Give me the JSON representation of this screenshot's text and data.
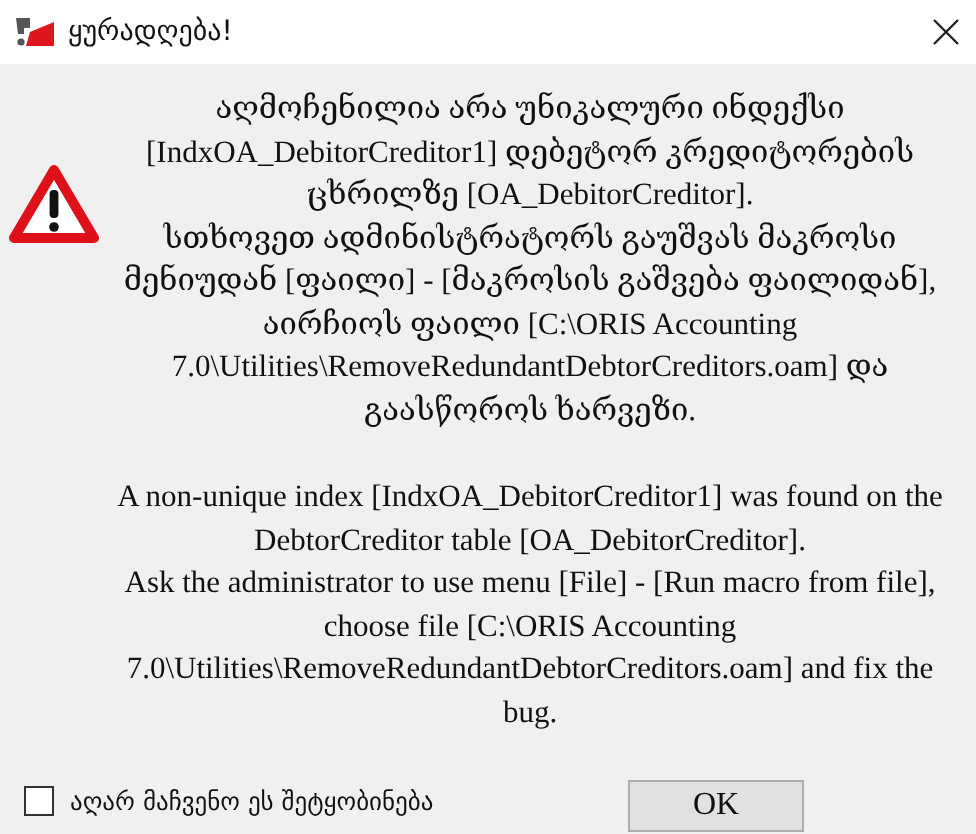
{
  "window": {
    "title": "ყურადღება!"
  },
  "message": {
    "georgian": [
      "აღმოჩენილია არა უნიკალური ინდექსი [IndxOA_DebitorCreditor1] დებეტორ კრედიტორების ცხრილზე [OA_DebitorCreditor].",
      "სთხოვეთ ადმინისტრატორს გაუშვას მაკროსი მენიუდან [ფაილი] - [მაკროსის გაშვება ფაილიდან], აირჩიოს ფაილი [C:\\ORIS Accounting 7.0\\Utilities\\RemoveRedundantDebtorCreditors.oam] და გაასწოროს ხარვეზი."
    ],
    "english": [
      "A non-unique index [IndxOA_DebitorCreditor1] was found on the DebtorCreditor table [OA_DebitorCreditor].",
      "Ask the administrator to use menu [File] - [Run macro from file], choose file [C:\\ORIS Accounting 7.0\\Utilities\\RemoveRedundantDebtorCreditors.oam] and fix the bug."
    ]
  },
  "dont_show_again": {
    "label": "აღარ მაჩვენო ეს შეტყობინება",
    "checked": false
  },
  "buttons": [
    "OK"
  ]
}
